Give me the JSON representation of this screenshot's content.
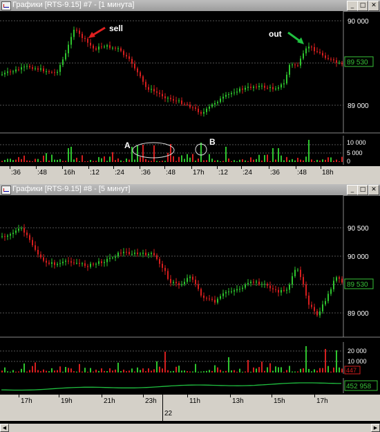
{
  "windows": [
    {
      "title": "Графики [RTS-9.15] #7 - [1 минута]",
      "controls": {
        "minimize": "_",
        "maximize": "□",
        "close": "✕"
      },
      "price_axis": [
        "90 000",
        "89 000"
      ],
      "price_tag": "89 530",
      "volume_axis": [
        "10 000",
        "5 000",
        "0"
      ],
      "time_axis": [
        ":36",
        ":48",
        "16h",
        ":12",
        ":24",
        ":36",
        ":48",
        "17h",
        ":12",
        ":24",
        ":36",
        ":48",
        "18h"
      ],
      "annotations": {
        "sell": "sell",
        "out": "out",
        "a": "A",
        "b": "B"
      },
      "colors": {
        "up": "#2ec42e",
        "down": "#d61e1e",
        "grid": "#555555",
        "sell_arrow": "#e02020",
        "out_arrow": "#20c040"
      }
    },
    {
      "title": "Графики [RTS-9.15] #8 - [5 минут]",
      "controls": {
        "minimize": "_",
        "maximize": "□",
        "close": "✕"
      },
      "price_axis": [
        "90 500",
        "90 000",
        "89 500",
        "89 000"
      ],
      "price_tag": "89 530",
      "volume_axis": [
        "20 000",
        "10 000"
      ],
      "volume_tag": "447",
      "indicator_tag": "452 958",
      "time_axis": [
        "17h",
        "19h",
        "21h",
        "23h",
        "11h",
        "13h",
        "15h",
        "17h"
      ],
      "date_label": "22",
      "colors": {
        "up": "#2ec42e",
        "down": "#d61e1e",
        "grid": "#555555",
        "indicator_up": "#20c040",
        "indicator_down": "#d61e1e"
      }
    }
  ],
  "scrollbar": {
    "left_icon": "arrow-left-icon",
    "right_icon": "arrow-right-icon"
  }
}
